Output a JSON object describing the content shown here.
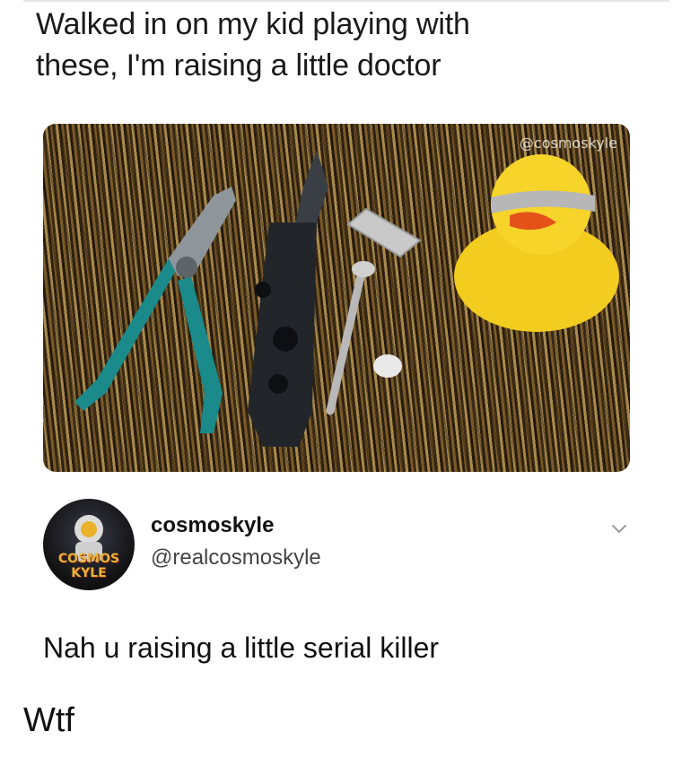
{
  "post": {
    "caption": "Walked in on my kid playing with\nthese, I'm raising a little doctor",
    "photo": {
      "watermark": "@cosmoskyle",
      "items": [
        "pliers-icon",
        "knife-icon",
        "razor-blade-icon",
        "screw-icon",
        "rubber-duck-icon"
      ]
    }
  },
  "reply": {
    "display_name": "cosmoskyle",
    "handle": "@realcosmoskyle",
    "avatar_text_line1": "COSMOS",
    "avatar_text_line2": "KYLE",
    "text": "Nah u raising a little serial killer"
  },
  "comment": "Wtf"
}
